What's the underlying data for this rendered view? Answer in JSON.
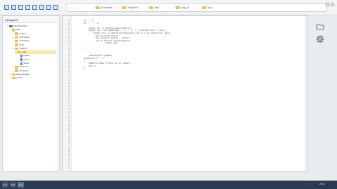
{
  "toolbar": {
    "icons": [
      "home-icon",
      "cloud-icon",
      "folder-icon",
      "document-icon",
      "document-icon",
      "document-icon",
      "folder-icon",
      "list-icon"
    ]
  },
  "address": {
    "back": "‹",
    "forward": "›",
    "crumbs": [
      "Documents",
      "Projects B",
      "data",
      "Logs_H",
      "App"
    ]
  },
  "sidebar": {
    "title": "Navigation",
    "items": [
      {
        "label": "Main Workstation",
        "level": 0,
        "kind": "root",
        "expanded": true
      },
      {
        "label": "Data",
        "level": 1,
        "kind": "folder",
        "expanded": true
      },
      {
        "label": "Projects",
        "level": 2,
        "kind": "folder"
      },
      {
        "label": "Old Projects",
        "level": 2,
        "kind": "folder"
      },
      {
        "label": "Old Projects",
        "level": 2,
        "kind": "folder"
      },
      {
        "label": "Notes",
        "level": 2,
        "kind": "folder"
      },
      {
        "label": "Project B",
        "level": 2,
        "kind": "folder",
        "expanded": true
      },
      {
        "label": "Logs",
        "level": 3,
        "kind": "folder",
        "selected": true
      },
      {
        "label": "Logs-H",
        "level": 4,
        "kind": "file"
      },
      {
        "label": "Logs-H",
        "level": 4,
        "kind": "file"
      },
      {
        "label": "Source",
        "level": 4,
        "kind": "file"
      },
      {
        "label": "Documents",
        "level": 2,
        "kind": "folder"
      },
      {
        "label": "Downloads",
        "level": 2,
        "kind": "folder"
      },
      {
        "label": "Backup Projects",
        "level": 1,
        "kind": "folder"
      },
      {
        "label": "Archive",
        "level": 1,
        "kind": "folder"
      }
    ]
  },
  "editor": {
    "line_start": 11,
    "line_count": 60,
    "lines": [
      "        hh  :  e",
      "        hh  : ' '  e,",
      "",
      "            prmvar tcr: a =define gesis(stats)==:",
      "            prmvar res = ecf_dataframe =  (  [  ]  ] / tutorial_test / { out }",
      "                prmvar tcr: a readrat getsis(parse).scr_so = etc prmvar tcr, @cos;",
      "                  ake openstar getcnt",
      "                  ake openstar getcnt   vem/in/,",
      "                  ure af rdmvrel getsisbegin(x):",
      "                          vinmat, @t;",
      "",
      "         ]",
      "",
      "",
      "            (billing.off.grease)",
      "        srcmd ale_n *  \"/\"  *",
      "        ]",
      "            padcery ujumo = fcure.sh, ar tcmenl",
      "            mine c;",
      "        ]"
    ]
  },
  "right_panel": {
    "icons": [
      "folder-icon",
      "gear-icon"
    ]
  },
  "taskbar": {
    "apps": [
      "Files",
      "Edit",
      "Term"
    ],
    "time": "2:26"
  }
}
